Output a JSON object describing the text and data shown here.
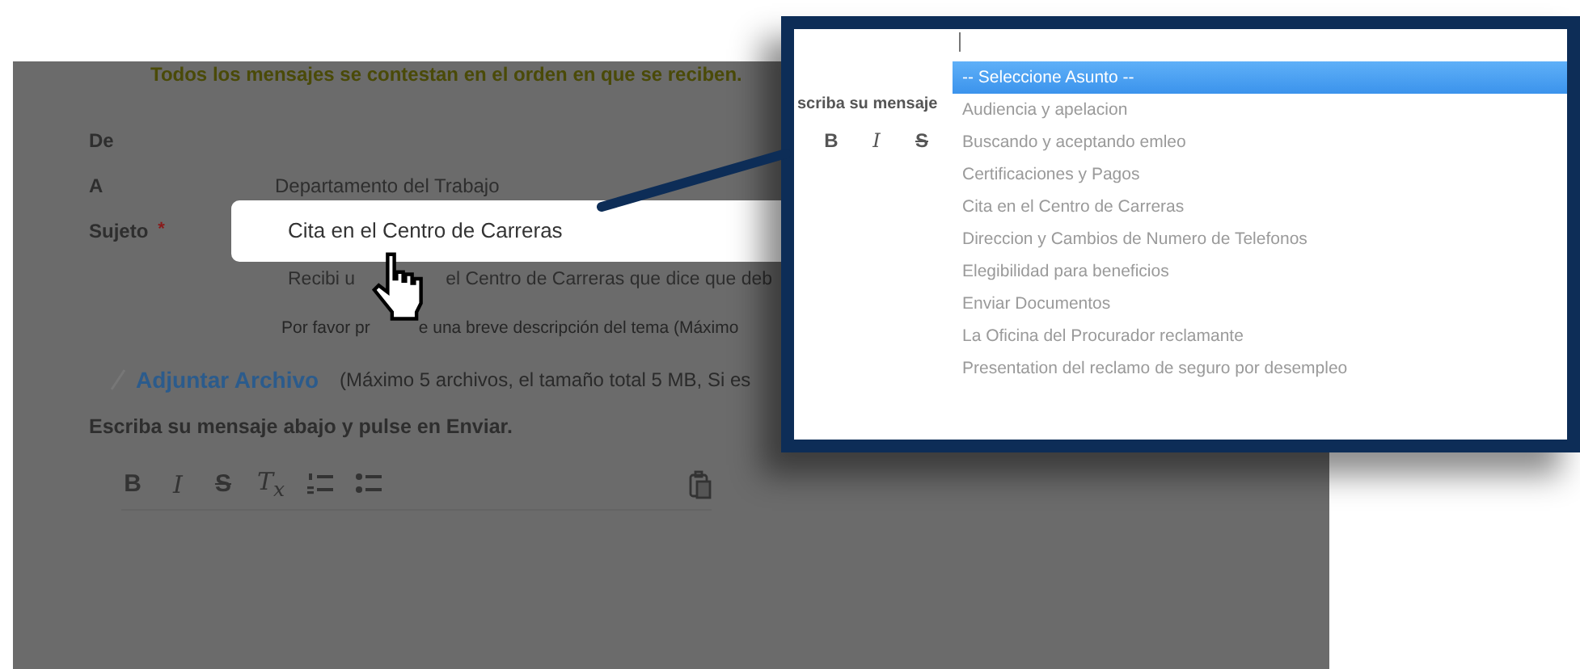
{
  "notice": "Todos los mensajes se contestan en el orden en que se reciben.",
  "fields": [
    {
      "label": "De",
      "required": false
    },
    {
      "label": "A",
      "required": false,
      "value": "Departamento del Trabajo"
    },
    {
      "label": "Sujeto",
      "required": true,
      "value": "Cita en el Centro de Carreras",
      "boxed": true
    }
  ],
  "required_mark": "*",
  "description_parts": [
    "Recibi u",
    "el Centro de Carreras que dice que deb"
  ],
  "placeholder_parts": [
    "Por favor pr",
    "e una breve descripción del tema (Máximo"
  ],
  "attachment": {
    "link": "Adjuntar Archivo",
    "note": "(Máximo 5 archivos, el tamaño total 5 MB, Si es"
  },
  "message_prompt": "Escriba su mensaje abajo y pulse en Enviar.",
  "toolbar": [
    {
      "kind": "bold",
      "label": "B"
    },
    {
      "kind": "italic",
      "label": "I"
    },
    {
      "kind": "strike",
      "label": "S"
    },
    {
      "kind": "clear",
      "label": "T$_{x}$"
    },
    {
      "kind": "ordered-list"
    },
    {
      "kind": "bullet-list"
    }
  ],
  "callout": {
    "prompt": "scriba su mensaje",
    "toolbar": [
      {
        "kind": "bold",
        "label": "B"
      },
      {
        "kind": "italic",
        "label": "I"
      },
      {
        "kind": "strike",
        "label": "S"
      }
    ],
    "options": [
      {
        "label": "-- Seleccione Asunto --",
        "selected": true
      },
      {
        "label": "Audiencia y apelacion",
        "selected": false
      },
      {
        "label": "Buscando y aceptando emleo",
        "selected": false
      },
      {
        "label": "Certificaciones y Pagos",
        "selected": false
      },
      {
        "label": "Cita en el Centro de Carreras",
        "selected": false
      },
      {
        "label": "Direccion y Cambios de Numero de Telefonos",
        "selected": false
      },
      {
        "label": "Elegibilidad para beneficios",
        "selected": false
      },
      {
        "label": "Enviar Documentos",
        "selected": false
      },
      {
        "label": "La Oficina del Procurador reclamante",
        "selected": false
      },
      {
        "label": "Presentation del reclamo de seguro por desempleo",
        "selected": false
      }
    ]
  }
}
